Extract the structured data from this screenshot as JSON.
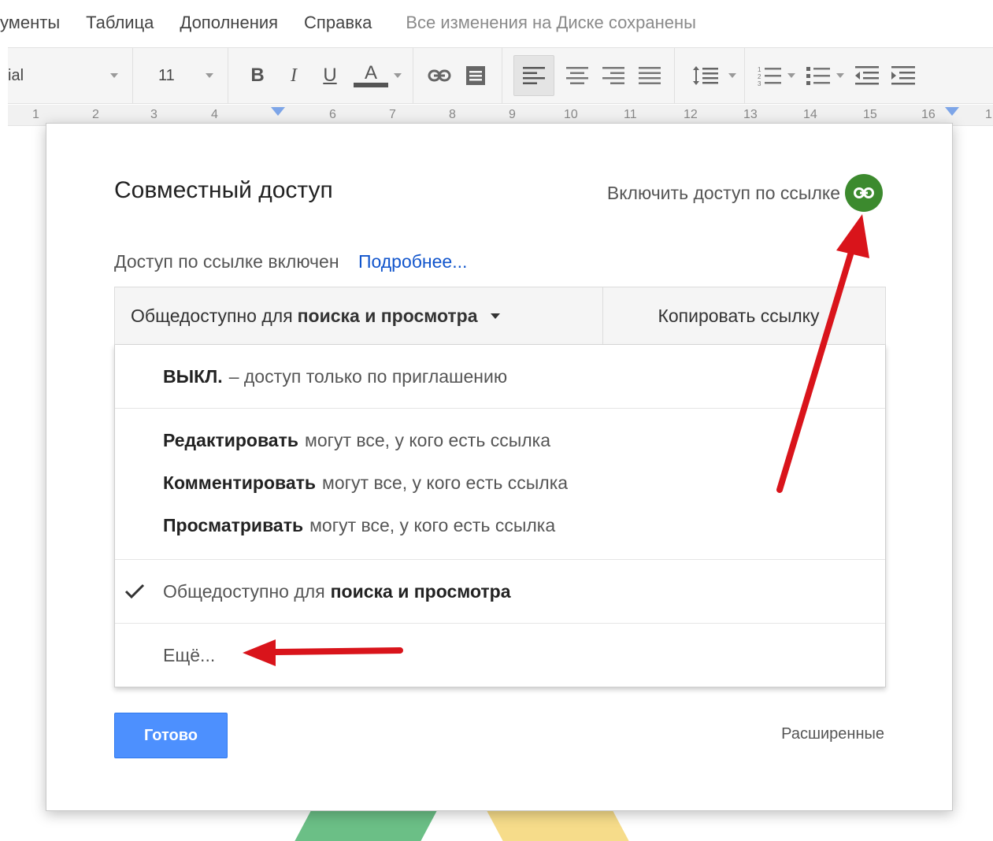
{
  "menubar": {
    "items": [
      "ументы",
      "Таблица",
      "Дополнения",
      "Справка"
    ],
    "saved_status": "Все изменения на Диске сохранены"
  },
  "toolbar": {
    "font_name": "ial",
    "font_size": "11",
    "bold_label": "B",
    "italic_label": "I",
    "underline_label": "U",
    "text_color_label": "A",
    "text_color_bar": "#555555"
  },
  "ruler": {
    "numbers": [
      "1",
      "2",
      "3",
      "4",
      "6",
      "7",
      "8",
      "9",
      "10",
      "11",
      "12",
      "13",
      "14",
      "15",
      "16",
      "1"
    ]
  },
  "dialog": {
    "title": "Совместный доступ",
    "link_toggle_label": "Включить доступ по ссылке",
    "link_status": "Доступ по ссылке включен",
    "learn_more": "Подробнее...",
    "access": {
      "selected_prefix": "Общедоступно для",
      "selected_bold": "поиска и просмотра",
      "copy_link": "Копировать ссылку"
    },
    "menu": {
      "off": {
        "bold": "ВЫКЛ.",
        "rest": "– доступ только по приглашению"
      },
      "link_options": [
        {
          "bold": "Редактировать",
          "rest": "могут все, у кого есть ссылка"
        },
        {
          "bold": "Комментировать",
          "rest": "могут все, у кого есть ссылка"
        },
        {
          "bold": "Просматривать",
          "rest": "могут все, у кого есть ссылка"
        }
      ],
      "public": {
        "prefix": "Общедоступно для",
        "bold": "поиска и просмотра",
        "checked": true
      },
      "more": "Ещё..."
    },
    "done_button": "Готово",
    "advanced_link": "Расширенные"
  },
  "colors": {
    "accent_blue": "#4d90fe",
    "link_blue": "#1155cc",
    "link_toggle_green": "#3c8a2e",
    "annotation_red": "#d9141b"
  }
}
